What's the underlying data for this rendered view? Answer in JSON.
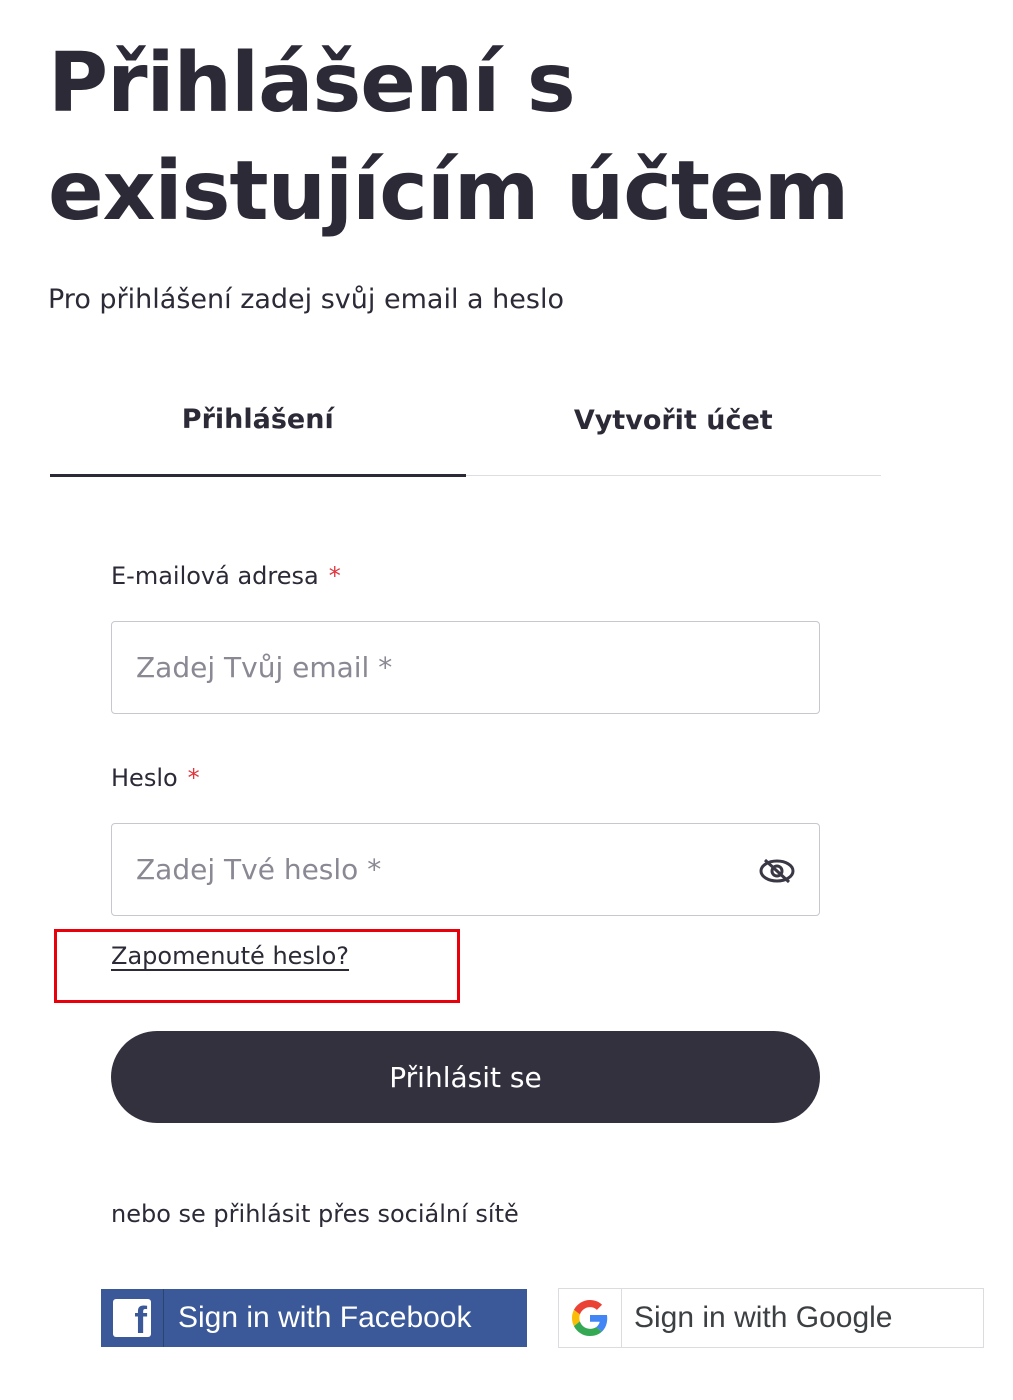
{
  "header": {
    "title": "Přihlášení s existujícím účtem",
    "subtitle": "Pro přihlášení zadej svůj email a heslo"
  },
  "tabs": [
    {
      "label": "Přihlášení",
      "active": true
    },
    {
      "label": "Vytvořit účet",
      "active": false
    }
  ],
  "form": {
    "email": {
      "label": "E-mailová adresa",
      "required_mark": "*",
      "placeholder": "Zadej Tvůj email *",
      "value": ""
    },
    "password": {
      "label": "Heslo",
      "required_mark": "*",
      "placeholder": "Zadej Tvé heslo *",
      "value": "",
      "toggle_icon": "eye-off-icon"
    },
    "forgot_label": "Zapomenuté heslo?",
    "submit_label": "Přihlásit se"
  },
  "social": {
    "text": "nebo se přihlásit přes sociální sítě",
    "facebook_label": "Sign in with Facebook",
    "google_label": "Sign in with Google"
  },
  "colors": {
    "text": "#2d2a37",
    "primary_button": "#34313e",
    "required": "#e0353d",
    "facebook": "#3b5998",
    "highlight": "#e8000b"
  }
}
